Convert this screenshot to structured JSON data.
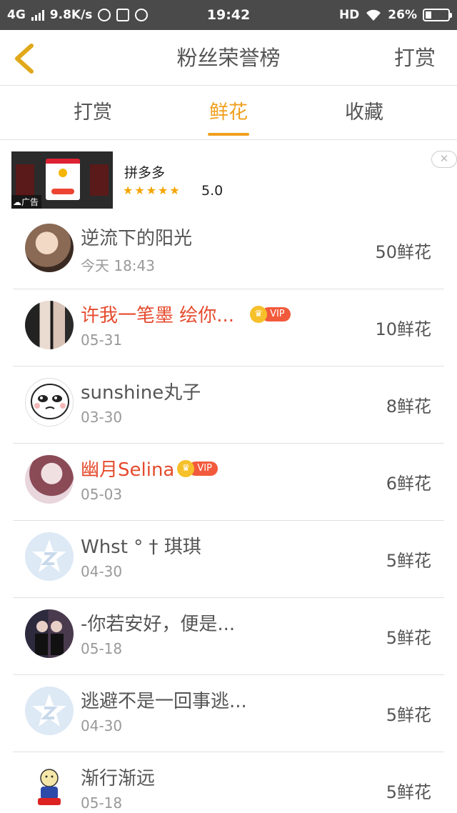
{
  "status_bar": {
    "network": "4G",
    "speed": "9.8K/s",
    "time": "19:42",
    "hd": "HD",
    "battery": "26%"
  },
  "header": {
    "title": "粉丝荣誉榜",
    "right_label": "打赏"
  },
  "tabs": [
    {
      "label": "打赏",
      "active": false
    },
    {
      "label": "鲜花",
      "active": true
    },
    {
      "label": "收藏",
      "active": false
    }
  ],
  "ad": {
    "label": "广告",
    "name": "拼多多",
    "stars": "★★★★★",
    "rating": "5.0",
    "close": "✕"
  },
  "list": [
    {
      "name": "逆流下的阳光",
      "date": "今天 18:43",
      "count": "50鲜花",
      "vip": false,
      "avatar": "photo-avatar"
    },
    {
      "name": "许我一笔墨 绘你...",
      "date": "05-31",
      "count": "10鲜花",
      "vip": true,
      "avatar": "couple-avatar"
    },
    {
      "name": "sunshine丸子",
      "date": "03-30",
      "count": "8鲜花",
      "vip": false,
      "avatar": "meme-avatar"
    },
    {
      "name": "幽月Selina",
      "date": "05-03",
      "count": "6鲜花",
      "vip": true,
      "avatar": "girl-avatar"
    },
    {
      "name": "Whst ° † 琪琪",
      "date": "04-30",
      "count": "5鲜花",
      "vip": false,
      "avatar": "default-qq-avatar"
    },
    {
      "name": "-你若安好，便是...",
      "date": "05-18",
      "count": "5鲜花",
      "vip": false,
      "avatar": "duo-avatar"
    },
    {
      "name": "逃避不是一回事逃...",
      "date": "04-30",
      "count": "5鲜花",
      "vip": false,
      "avatar": "default-qq-avatar"
    },
    {
      "name": "渐行渐远",
      "date": "05-18",
      "count": "5鲜花",
      "vip": false,
      "avatar": "cartoon-avatar"
    }
  ],
  "vip_label": "VIP",
  "colors": {
    "accent": "#f0a020",
    "vip_name": "#e54b2e",
    "status_bar": "#4a4a4a"
  }
}
